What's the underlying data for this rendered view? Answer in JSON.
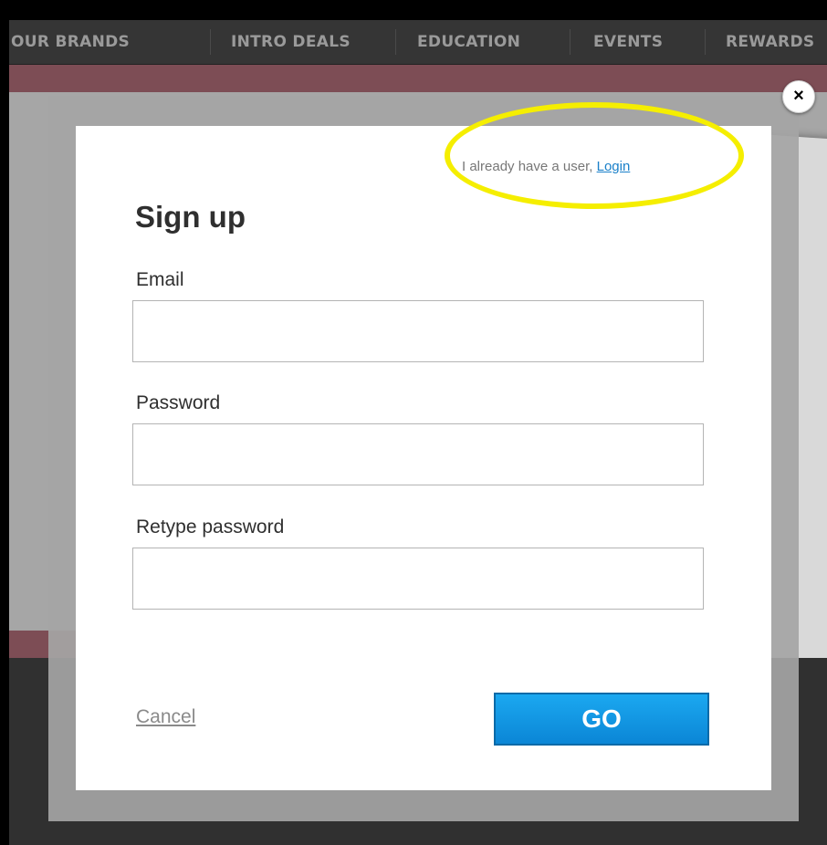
{
  "nav": {
    "items": [
      "OUR BRANDS",
      "INTRO DEALS",
      "EDUCATION",
      "EVENTS",
      "REWARDS"
    ]
  },
  "modal": {
    "close_label": "×",
    "already_user_text": "I already have a user,",
    "login_link": "Login",
    "title": "Sign up",
    "fields": [
      {
        "label": "Email",
        "value": "",
        "placeholder": ""
      },
      {
        "label": "Password",
        "value": "",
        "placeholder": ""
      },
      {
        "label": "Retype password",
        "value": "",
        "placeholder": ""
      }
    ],
    "cancel_label": "Cancel",
    "go_label": "GO"
  },
  "colors": {
    "accent": "#1a80c9",
    "button": "#0b86d6",
    "highlight": "#f5ee00",
    "nav_bg": "#353535"
  }
}
